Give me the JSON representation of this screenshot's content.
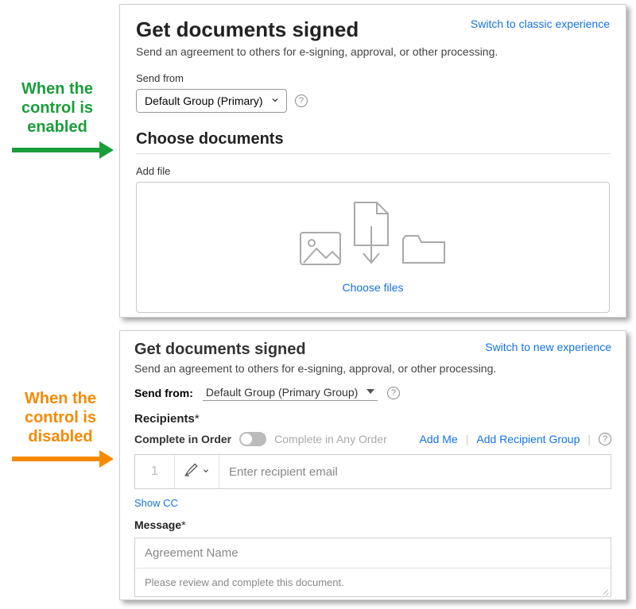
{
  "annotations": {
    "enabled": "When the control is enabled",
    "disabled": "When the control is disabled"
  },
  "panel1": {
    "title": "Get documents signed",
    "switch_link": "Switch to classic experience",
    "subtitle": "Send an agreement to others for e-signing, approval, or other processing.",
    "sendfrom_label": "Send from",
    "sendfrom_value": "Default Group (Primary)",
    "section_title": "Choose documents",
    "addfile_label": "Add file",
    "choose_files": "Choose files"
  },
  "panel2": {
    "title": "Get documents signed",
    "switch_link": "Switch to new experience",
    "subtitle": "Send an agreement to others for e-signing, approval, or other processing.",
    "sendfrom_label": "Send from:",
    "sendfrom_value": "Default Group (Primary Group)",
    "recipients_label": "Recipients",
    "asterisk": "*",
    "complete_in_order": "Complete in Order",
    "complete_any_order": "Complete in Any Order",
    "add_me": "Add Me",
    "add_group": "Add Recipient Group",
    "row_number": "1",
    "recipient_placeholder": "Enter recipient email",
    "show_cc": "Show CC",
    "message_label": "Message",
    "agreement_name_placeholder": "Agreement Name",
    "message_body_placeholder": "Please review and complete this document."
  }
}
